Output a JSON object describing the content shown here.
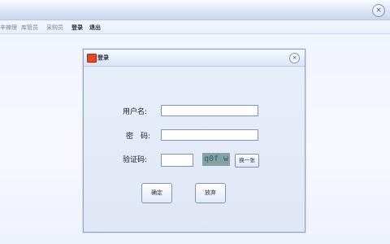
{
  "window": {
    "close_glyph": "×"
  },
  "menubar": {
    "items": [
      {
        "label": "辛辣理"
      },
      {
        "label": "库管员"
      },
      {
        "label": "采购员"
      },
      {
        "label": "登录"
      },
      {
        "label": "退出"
      }
    ],
    "active_items": [
      "登录",
      "退出"
    ]
  },
  "dialog": {
    "title": "登录",
    "close_glyph": "×",
    "username_label": "用户名:",
    "password_label": "密　码:",
    "captcha_label": "验证码:",
    "username_value": "",
    "password_value": "",
    "captcha_value": "",
    "captcha_text": "q0f w",
    "refresh_label": "换一张",
    "confirm_label": "确定",
    "cancel_label": "放弃"
  },
  "colors": {
    "accent": "#8ea4c8",
    "dialog_bg": "#e4ebf8",
    "captcha_bg": "#86a3a3",
    "title_icon": "#e04b26"
  },
  "icons": {
    "window_close": "close-icon",
    "dialog_icon": "app-icon",
    "dialog_close": "close-icon"
  }
}
